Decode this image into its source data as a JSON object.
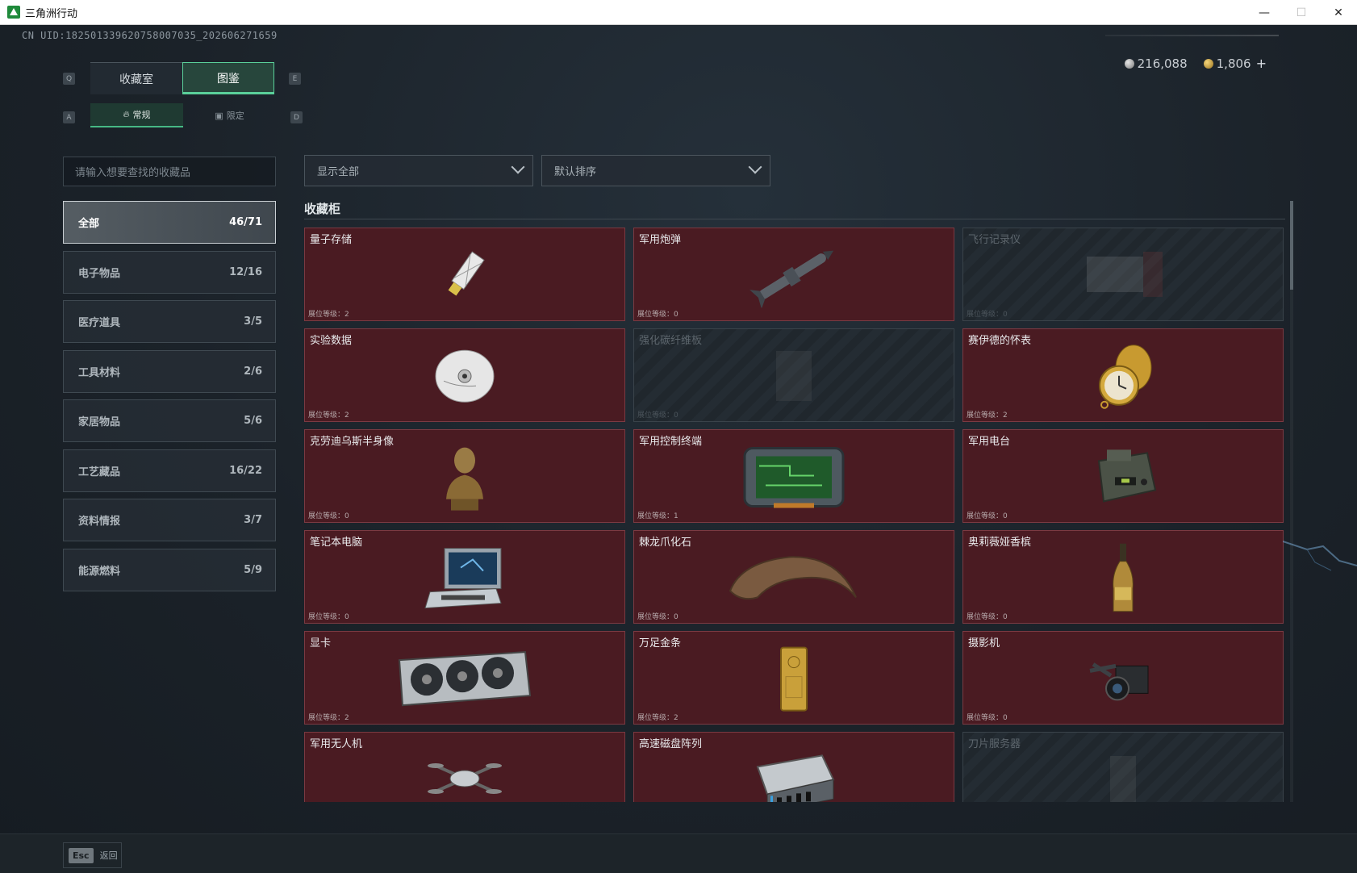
{
  "window": {
    "title": "三角洲行动",
    "minimize": "—",
    "maximize": "☐",
    "close": "✕"
  },
  "uid": "CN UID:1825013396207580070​35_202606271659",
  "currency": {
    "silver": "216,088",
    "gold": "1,806",
    "add": "+"
  },
  "keys": {
    "q": "Q",
    "e": "E",
    "a": "A",
    "d": "D"
  },
  "tabs": [
    {
      "label": "收藏室"
    },
    {
      "label": "图鉴"
    }
  ],
  "subtabs": [
    {
      "label": "常规"
    },
    {
      "label": "限定"
    }
  ],
  "search": {
    "placeholder": "请输入想要查找的收藏品"
  },
  "filters": {
    "show": "显示全部",
    "sort": "默认排序"
  },
  "categories": [
    {
      "label": "全部",
      "count": "46/71"
    },
    {
      "label": "电子物品",
      "count": "12/16"
    },
    {
      "label": "医疗道具",
      "count": "3/5"
    },
    {
      "label": "工具材料",
      "count": "2/6"
    },
    {
      "label": "家居物品",
      "count": "5/6"
    },
    {
      "label": "工艺藏品",
      "count": "16/22"
    },
    {
      "label": "资料情报",
      "count": "3/7"
    },
    {
      "label": "能源燃料",
      "count": "5/9"
    }
  ],
  "section_title": "收藏柜",
  "items": [
    {
      "name": "量子存储",
      "level": "展位等级：2",
      "art": "usb-drive-icon",
      "locked": false
    },
    {
      "name": "军用炮弹",
      "level": "展位等级：0",
      "art": "missile-icon",
      "locked": false
    },
    {
      "name": "飞行记录仪",
      "level": "展位等级：0",
      "art": "flight-recorder-icon",
      "locked": true
    },
    {
      "name": "实验数据",
      "level": "展位等级：2",
      "art": "disc-icon",
      "locked": false
    },
    {
      "name": "强化碳纤维板",
      "level": "展位等级：0",
      "art": "carbon-plate-icon",
      "locked": true
    },
    {
      "name": "赛伊德的怀表",
      "level": "展位等级：2",
      "art": "pocket-watch-icon",
      "locked": false
    },
    {
      "name": "克劳迪乌斯半身像",
      "level": "展位等级：0",
      "art": "bust-icon",
      "locked": false
    },
    {
      "name": "军用控制终端",
      "level": "展位等级：1",
      "art": "control-terminal-icon",
      "locked": false
    },
    {
      "name": "军用电台",
      "level": "展位等级：0",
      "art": "radio-icon",
      "locked": false
    },
    {
      "name": "笔记本电脑",
      "level": "展位等级：0",
      "art": "laptop-icon",
      "locked": false
    },
    {
      "name": "棘龙爪化石",
      "level": "展位等级：0",
      "art": "claw-fossil-icon",
      "locked": false
    },
    {
      "name": "奥莉薇娅香槟",
      "level": "展位等级：0",
      "art": "champagne-icon",
      "locked": false
    },
    {
      "name": "显卡",
      "level": "展位等级：2",
      "art": "gpu-icon",
      "locked": false
    },
    {
      "name": "万足金条",
      "level": "展位等级：2",
      "art": "gold-bar-icon",
      "locked": false
    },
    {
      "name": "摄影机",
      "level": "展位等级：0",
      "art": "camera-icon",
      "locked": false
    },
    {
      "name": "军用无人机",
      "level": "",
      "art": "drone-icon",
      "locked": false
    },
    {
      "name": "高速磁盘阵列",
      "level": "",
      "art": "disk-array-icon",
      "locked": false
    },
    {
      "name": "刀片服务器",
      "level": "",
      "art": "blade-server-icon",
      "locked": true
    }
  ],
  "bottom": {
    "esc_key": "Esc",
    "back": "返回"
  },
  "colors": {
    "accent": "#5ad09a",
    "card_bg": "#4a1b22",
    "card_border": "#7b3a42"
  }
}
